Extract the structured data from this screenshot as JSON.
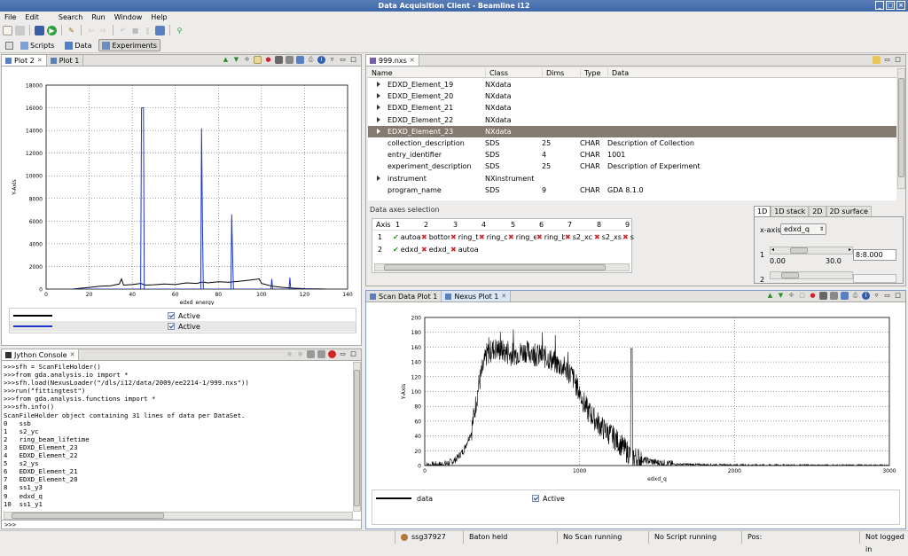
{
  "window": {
    "title": "Data Acquisition Client - Beamline i12"
  },
  "menu": [
    "File",
    "Edit",
    "Search",
    "Run",
    "Window",
    "Help"
  ],
  "perspectives": [
    {
      "label": "Scripts",
      "icon": "script-icon"
    },
    {
      "label": "Data",
      "icon": "data-icon"
    },
    {
      "label": "Experiments",
      "icon": "experiments-icon",
      "selected": true
    }
  ],
  "plot_panel": {
    "tabs": [
      "Plot 2",
      "Plot 1"
    ],
    "ylabel": "Y-Axis",
    "xlabel": "edxd_energy",
    "legend": [
      {
        "color": "#000000",
        "active": "Active"
      },
      {
        "color": "#1f35c9",
        "active": "Active"
      }
    ]
  },
  "console": {
    "tab": "Jython Console",
    "lines": [
      ">>>sfh = ScanFileHolder()",
      ">>>from gda.analysis.io import *",
      ">>>sfh.load(NexusLoader(\"/dls/i12/data/2009/ee2214-1/999.nxs\"))",
      ">>>run(\"fittingtest\")",
      ">>>from gda.analysis.functions import *",
      ">>>sfh.info()",
      "ScanFileHolder object containing 31 lines of data per DataSet.",
      "0   ssb",
      "1   s2_yc",
      "2   ring_beam_lifetime",
      "3   EDXD_Element_23",
      "4   EDXD_Element_22",
      "5   s2_ys",
      "6   EDXD_Element_21",
      "7   EDXD_Element_20",
      "8   ss1_y3",
      "9   edxd_q",
      "10  ss1_y1"
    ],
    "prompt": ">>>"
  },
  "nexus_tree": {
    "tab": "999.nxs",
    "columns": [
      "Name",
      "Class",
      "Dims",
      "Type",
      "Data"
    ],
    "rows": [
      {
        "name": "EDXD_Element_19",
        "cls": "NXdata",
        "dims": "",
        "type": "",
        "data": "",
        "expand": true
      },
      {
        "name": "EDXD_Element_20",
        "cls": "NXdata",
        "dims": "",
        "type": "",
        "data": "",
        "expand": true
      },
      {
        "name": "EDXD_Element_21",
        "cls": "NXdata",
        "dims": "",
        "type": "",
        "data": "",
        "expand": true
      },
      {
        "name": "EDXD_Element_22",
        "cls": "NXdata",
        "dims": "",
        "type": "",
        "data": "",
        "expand": true
      },
      {
        "name": "EDXD_Element_23",
        "cls": "NXdata",
        "dims": "",
        "type": "",
        "data": "",
        "expand": true,
        "selected": true
      },
      {
        "name": "collection_description",
        "cls": "SDS",
        "dims": "25",
        "type": "CHAR",
        "data": "Description of Collection",
        "expand": false
      },
      {
        "name": "entry_identifier",
        "cls": "SDS",
        "dims": "4",
        "type": "CHAR",
        "data": "1001",
        "expand": false
      },
      {
        "name": "experiment_description",
        "cls": "SDS",
        "dims": "25",
        "type": "CHAR",
        "data": "Description of Experiment",
        "expand": false
      },
      {
        "name": "instrument",
        "cls": "NXinstrument",
        "dims": "",
        "type": "",
        "data": "",
        "expand": true
      },
      {
        "name": "program_name",
        "cls": "SDS",
        "dims": "9",
        "type": "CHAR",
        "data": "GDA 8.1.0",
        "expand": false
      }
    ]
  },
  "axes_selection": {
    "title": "Data axes selection",
    "headers": [
      "Axis",
      "1",
      "2",
      "3",
      "4",
      "5",
      "6",
      "7",
      "8",
      "9"
    ],
    "rows": [
      {
        "axis": "1",
        "cells": [
          {
            "ok": true,
            "t": "autoa"
          },
          {
            "ok": false,
            "t": "bottor"
          },
          {
            "ok": false,
            "t": "ring_t"
          },
          {
            "ok": false,
            "t": "ring_c"
          },
          {
            "ok": false,
            "t": "ring_e"
          },
          {
            "ok": false,
            "t": "ring_b"
          },
          {
            "ok": false,
            "t": "s2_xc"
          },
          {
            "ok": false,
            "t": "s2_xs"
          },
          {
            "ok": false,
            "t": "s"
          }
        ]
      },
      {
        "axis": "2",
        "cells": [
          {
            "ok": true,
            "t": "edxd_"
          },
          {
            "ok": false,
            "t": "edxd_"
          },
          {
            "ok": false,
            "t": "autoa"
          }
        ]
      }
    ]
  },
  "view_tabs": [
    "1D",
    "1D stack",
    "2D",
    "2D surface"
  ],
  "view_1d": {
    "xaxis_label": "x-axis",
    "xaxis_value": "edxd_q",
    "row_label": "1",
    "slider_min": "0.00",
    "slider_max": "30.0",
    "range_value": "8:8.000",
    "row2_label": "2"
  },
  "scan_panel": {
    "tabs": [
      "Scan Data Plot 1",
      "Nexus Plot 1"
    ],
    "ylabel": "Y-Axis",
    "xlabel": "edxd_q",
    "legend_name": "data",
    "legend_active": "Active"
  },
  "status": {
    "user": "ssg37927",
    "baton": "Baton held",
    "scan": "No Scan running",
    "script": "No Script running",
    "pos": "Pos:",
    "login": "Not logged in"
  },
  "chart_data": [
    {
      "type": "line",
      "title": "",
      "xlabel": "edxd_energy",
      "ylabel": "Y-Axis",
      "xlim": [
        0,
        140
      ],
      "ylim": [
        0,
        18000
      ],
      "xticks": [
        0,
        20,
        40,
        60,
        80,
        100,
        120,
        140
      ],
      "yticks": [
        0,
        2000,
        4000,
        6000,
        8000,
        10000,
        12000,
        14000,
        16000,
        18000
      ],
      "grid": true,
      "series": [
        {
          "color": "#000000",
          "x": [
            12,
            20,
            25,
            30,
            34,
            35,
            36,
            40,
            44,
            46,
            50,
            55,
            60,
            65,
            70,
            72,
            73.5,
            75,
            80,
            85,
            90,
            95,
            99,
            100,
            102,
            105,
            110,
            115,
            120,
            125,
            130
          ],
          "y": [
            0,
            150,
            250,
            300,
            450,
            900,
            350,
            400,
            500,
            350,
            380,
            450,
            400,
            550,
            500,
            600,
            600,
            550,
            650,
            600,
            700,
            800,
            900,
            500,
            400,
            250,
            150,
            80,
            40,
            20,
            0
          ]
        },
        {
          "color": "#1f35c9",
          "x": [
            12,
            43.9,
            44.3,
            44.8,
            45.2,
            45.6,
            71.8,
            72.2,
            72.6,
            73,
            85.8,
            86.2,
            86.6,
            87,
            104.4,
            104.8,
            105.2,
            112.8,
            113.2,
            113.6,
            125
          ],
          "y": [
            0,
            0,
            16000,
            16000,
            16000,
            0,
            0,
            14200,
            6000,
            0,
            0,
            6600,
            3000,
            0,
            0,
            900,
            0,
            0,
            1000,
            0,
            0
          ]
        }
      ]
    },
    {
      "type": "line",
      "title": "",
      "xlabel": "edxd_q",
      "ylabel": "Y-Axis",
      "xlim": [
        0,
        3000
      ],
      "ylim": [
        0,
        200
      ],
      "xticks": [
        0,
        1000,
        2000,
        3000
      ],
      "yticks": [
        0,
        20,
        40,
        60,
        80,
        100,
        120,
        140,
        160,
        180,
        200
      ],
      "grid": true,
      "series": [
        {
          "name": "data",
          "color": "#000000",
          "x": [
            0,
            100,
            150,
            200,
            250,
            300,
            350,
            400,
            450,
            500,
            550,
            600,
            650,
            700,
            750,
            800,
            850,
            900,
            950,
            1000,
            1050,
            1100,
            1150,
            1200,
            1250,
            1300,
            1350,
            1400,
            1500,
            1600,
            1800,
            2000,
            2200,
            2400,
            2600,
            2800,
            3000
          ],
          "y": [
            0,
            1,
            3,
            8,
            20,
            45,
            110,
            150,
            158,
            155,
            150,
            152,
            155,
            150,
            148,
            145,
            138,
            132,
            122,
            98,
            75,
            62,
            50,
            42,
            32,
            20,
            12,
            8,
            4,
            2,
            1,
            0.6,
            0.4,
            0.3,
            0.1,
            0,
            0
          ]
        }
      ]
    }
  ]
}
